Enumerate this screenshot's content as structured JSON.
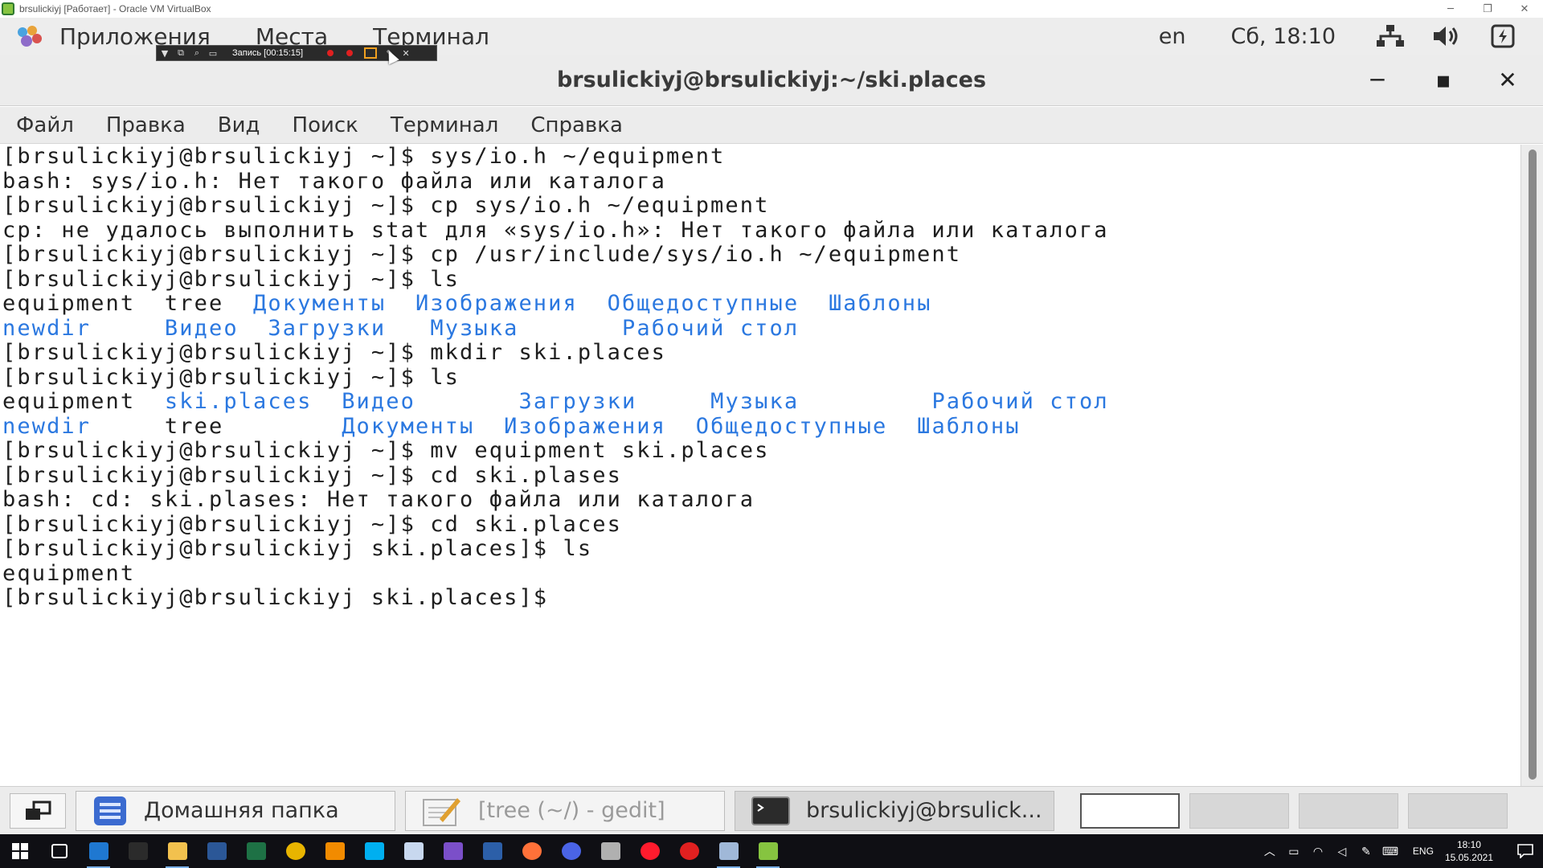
{
  "vbox": {
    "title": "brsulickiyj [Работает] - Oracle VM VirtualBox",
    "min": "─",
    "restore": "❐",
    "close": "✕"
  },
  "gnome_panel": {
    "menus": [
      "Приложения",
      "Места",
      "Терминал"
    ],
    "lang": "en",
    "clock": "Сб, 18:10"
  },
  "recorder": {
    "label": "Запись [00:15:15]"
  },
  "terminal": {
    "title": "brsulickiyj@brsulickiyj:~/ski.places",
    "min": "─",
    "max": "▪",
    "close": "✕",
    "menus": [
      "Файл",
      "Правка",
      "Вид",
      "Поиск",
      "Терминал",
      "Справка"
    ],
    "lines": [
      [
        {
          "t": "[brsulickiyj@brsulickiyj ~]$ sys/io.h ~/equipment"
        }
      ],
      [
        {
          "t": "bash: sys/io.h: Нет такого файла или каталога"
        }
      ],
      [
        {
          "t": "[brsulickiyj@brsulickiyj ~]$ cp sys/io.h ~/equipment"
        }
      ],
      [
        {
          "t": "cp: не удалось выполнить stat для «sys/io.h»: Нет такого файла или каталога"
        }
      ],
      [
        {
          "t": "[brsulickiyj@brsulickiyj ~]$ cp /usr/include/sys/io.h ~/equipment"
        }
      ],
      [
        {
          "t": "[brsulickiyj@brsulickiyj ~]$ ls"
        }
      ],
      [
        {
          "t": "equipment  tree  "
        },
        {
          "t": "Документы",
          "d": true
        },
        {
          "t": "  "
        },
        {
          "t": "Изображения",
          "d": true
        },
        {
          "t": "  "
        },
        {
          "t": "Общедоступные",
          "d": true
        },
        {
          "t": "  "
        },
        {
          "t": "Шаблоны",
          "d": true
        }
      ],
      [
        {
          "t": "newdir",
          "d": true
        },
        {
          "t": "     "
        },
        {
          "t": "Видео",
          "d": true
        },
        {
          "t": "  "
        },
        {
          "t": "Загрузки",
          "d": true
        },
        {
          "t": "   "
        },
        {
          "t": "Музыка",
          "d": true
        },
        {
          "t": "       "
        },
        {
          "t": "Рабочий стол",
          "d": true
        }
      ],
      [
        {
          "t": "[brsulickiyj@brsulickiyj ~]$ mkdir ski.places"
        }
      ],
      [
        {
          "t": "[brsulickiyj@brsulickiyj ~]$ ls"
        }
      ],
      [
        {
          "t": "equipment  "
        },
        {
          "t": "ski.places",
          "d": true
        },
        {
          "t": "  "
        },
        {
          "t": "Видео",
          "d": true
        },
        {
          "t": "       "
        },
        {
          "t": "Загрузки",
          "d": true
        },
        {
          "t": "     "
        },
        {
          "t": "Музыка",
          "d": true
        },
        {
          "t": "         "
        },
        {
          "t": "Рабочий стол",
          "d": true
        }
      ],
      [
        {
          "t": "newdir",
          "d": true
        },
        {
          "t": "     tree        "
        },
        {
          "t": "Документы",
          "d": true
        },
        {
          "t": "  "
        },
        {
          "t": "Изображения",
          "d": true
        },
        {
          "t": "  "
        },
        {
          "t": "Общедоступные",
          "d": true
        },
        {
          "t": "  "
        },
        {
          "t": "Шаблоны",
          "d": true
        }
      ],
      [
        {
          "t": "[brsulickiyj@brsulickiyj ~]$ mv equipment ski.places"
        }
      ],
      [
        {
          "t": "[brsulickiyj@brsulickiyj ~]$ cd ski.plases"
        }
      ],
      [
        {
          "t": "bash: cd: ski.plases: Нет такого файла или каталога"
        }
      ],
      [
        {
          "t": "[brsulickiyj@brsulickiyj ~]$ cd ski.places"
        }
      ],
      [
        {
          "t": "[brsulickiyj@brsulickiyj ski.places]$ ls"
        }
      ],
      [
        {
          "t": "equipment"
        }
      ],
      [
        {
          "t": "[brsulickiyj@brsulickiyj ski.places]$ "
        }
      ]
    ]
  },
  "gnome_taskbar": {
    "tasks": [
      {
        "label": "Домашняя папка",
        "icon": "folder-icon",
        "dim": false,
        "active": false
      },
      {
        "label": "[tree (~/) - gedit]",
        "icon": "gedit-icon",
        "dim": true,
        "active": false
      },
      {
        "label": "brsulickiyj@brsulick...",
        "icon": "terminal-icon",
        "dim": false,
        "active": true
      }
    ]
  },
  "win_taskbar": {
    "pinned": [
      {
        "name": "task-view-icon",
        "color": "#0f0f14"
      },
      {
        "name": "edge-icon",
        "color": "#1f78d1"
      },
      {
        "name": "cmd-icon",
        "color": "#2b2b2b"
      },
      {
        "name": "explorer-icon",
        "color": "#f2c14e"
      },
      {
        "name": "word-icon",
        "color": "#2b5797"
      },
      {
        "name": "excel-icon",
        "color": "#1e7145"
      },
      {
        "name": "chrome-icon",
        "color": "#e8b400"
      },
      {
        "name": "app-icon",
        "color": "#f28b00"
      },
      {
        "name": "skype-icon",
        "color": "#00aff0"
      },
      {
        "name": "notepad-icon",
        "color": "#c8d8ef"
      },
      {
        "name": "visual-studio-icon",
        "color": "#7b4fc9"
      },
      {
        "name": "steam-icon",
        "color": "#2c5fa8"
      },
      {
        "name": "firefox-icon",
        "color": "#ff7139"
      },
      {
        "name": "firefox-dev-icon",
        "color": "#4a64e6"
      },
      {
        "name": "files-icon",
        "color": "#b0b0b0"
      },
      {
        "name": "opera-icon",
        "color": "#ff1b2d"
      },
      {
        "name": "record-icon",
        "color": "#e02020"
      },
      {
        "name": "virtualbox-icon",
        "color": "#a0b8d8"
      },
      {
        "name": "virtualbox-vm-icon",
        "color": "#86c440"
      }
    ],
    "lang": "ENG",
    "time": "18:10",
    "date": "15.05.2021"
  }
}
